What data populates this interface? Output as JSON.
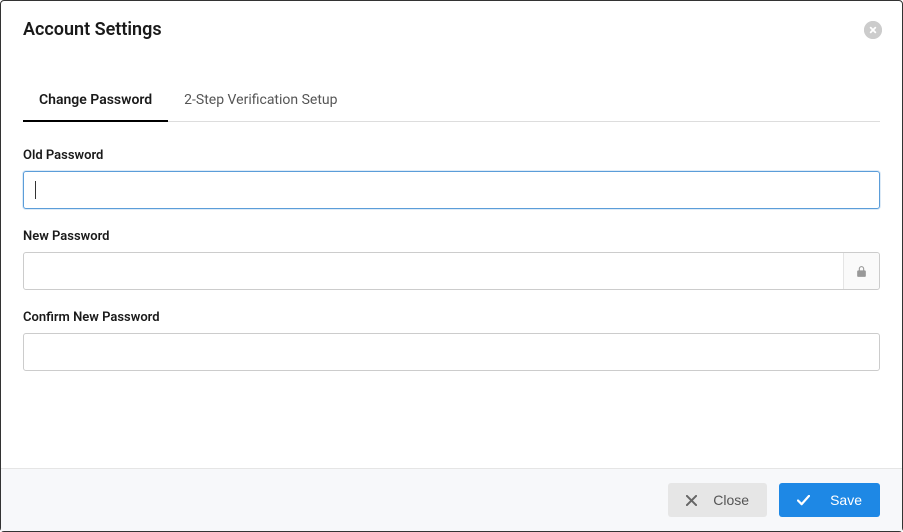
{
  "header": {
    "title": "Account Settings"
  },
  "tabs": [
    {
      "label": "Change Password",
      "active": true
    },
    {
      "label": "2-Step Verification Setup",
      "active": false
    }
  ],
  "form": {
    "old_password": {
      "label": "Old Password",
      "value": ""
    },
    "new_password": {
      "label": "New Password",
      "value": ""
    },
    "confirm_password": {
      "label": "Confirm New Password",
      "value": ""
    }
  },
  "footer": {
    "close_label": "Close",
    "save_label": "Save"
  },
  "icons": {
    "close": "close-circle",
    "lock": "lock",
    "x": "x-mark",
    "check": "check-mark"
  }
}
